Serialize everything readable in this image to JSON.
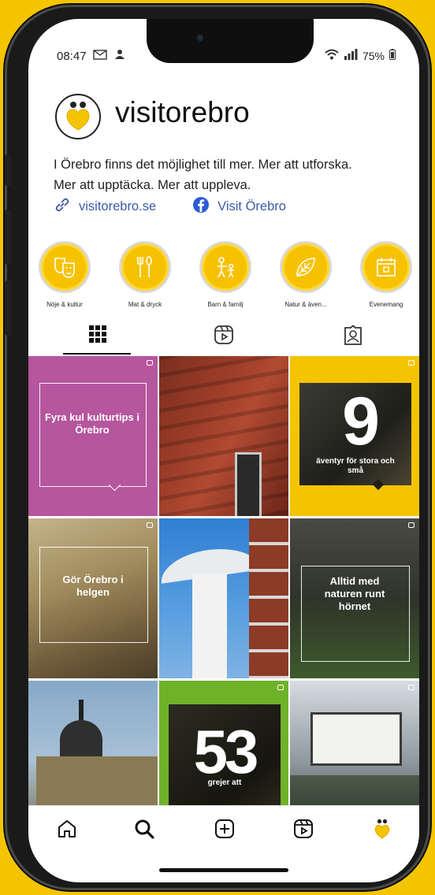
{
  "status": {
    "time": "08:47",
    "battery": "75%"
  },
  "profile": {
    "username": "visitorebro",
    "bio_line1": "I Örebro finns det möjlighet till mer. Mer att utforska.",
    "bio_line2": "Mer att upptäcka. Mer att uppleva.",
    "website": "visitorebro.se",
    "facebook": "Visit Örebro"
  },
  "highlights": [
    {
      "label": "Nöje & kultur"
    },
    {
      "label": "Mat & dryck"
    },
    {
      "label": "Barn & familj"
    },
    {
      "label": "Natur & även..."
    },
    {
      "label": "Evenemang"
    }
  ],
  "posts": {
    "p1": "Fyra kul kulturtips i Örebro",
    "p3_number": "9",
    "p3_caption": "äventyr för stora och små",
    "p4": "Gör Örebro i helgen",
    "p6": "Alltid med naturen runt hörnet",
    "p8_number": "53",
    "p8_caption": "grejer att"
  },
  "colors": {
    "accent": "#f5c400",
    "link": "#3a5aa8",
    "purple": "#b5569e",
    "green": "#6fb22a"
  }
}
